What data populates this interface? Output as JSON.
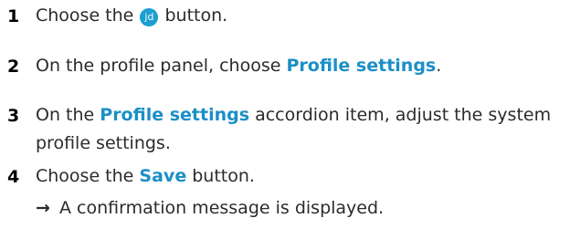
{
  "steps": [
    {
      "number": "1",
      "before": "Choose the",
      "avatar_text": "jd",
      "after": "button."
    },
    {
      "number": "2",
      "before": "On the profile panel, choose",
      "emphasis": "Profile settings",
      "after": "."
    },
    {
      "number": "3",
      "before": "On the",
      "emphasis": "Profile settings",
      "after": "accordion item, adjust the system profile settings."
    },
    {
      "number": "4",
      "before": "Choose the",
      "emphasis": "Save",
      "after": "button."
    }
  ],
  "result": {
    "arrow": "→",
    "text": "A confirmation message is displayed."
  },
  "colors": {
    "emphasis": "#1b8fc6",
    "avatar_bg": "#1b9fd0",
    "text": "#2b2b2b"
  },
  "icons": {
    "avatar": "user-avatar-icon",
    "result": "right-arrow-icon"
  }
}
